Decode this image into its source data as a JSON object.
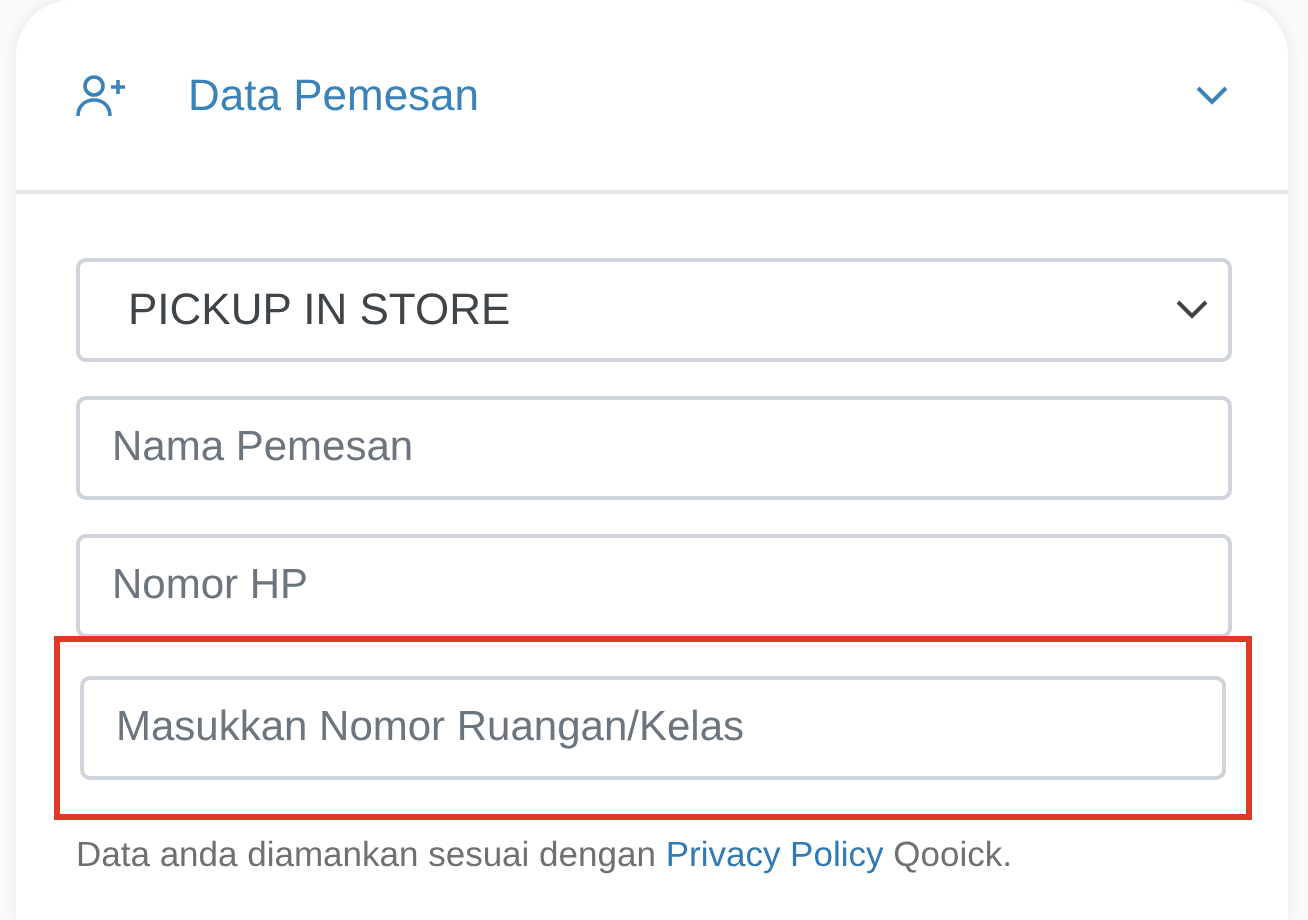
{
  "section": {
    "title": "Data Pemesan",
    "expanded": true
  },
  "fields": [
    {
      "kind": "select",
      "value": "PICKUP IN STORE",
      "highlighted": false
    },
    {
      "kind": "input",
      "placeholder": "Nama Pemesan",
      "highlighted": false
    },
    {
      "kind": "input",
      "placeholder": "Nomor HP",
      "highlighted": false
    },
    {
      "kind": "input",
      "placeholder": "Masukkan Nomor Ruangan/Kelas",
      "highlighted": true
    }
  ],
  "privacy_note": {
    "before": "Data anda diamankan sesuai dengan",
    "link": "Privacy Policy",
    "after": "Qooick."
  }
}
